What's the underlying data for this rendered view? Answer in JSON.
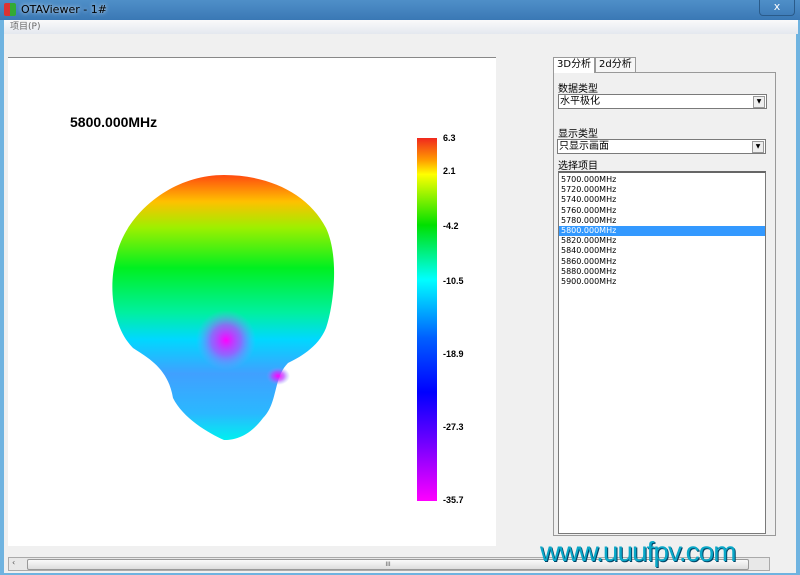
{
  "window": {
    "title": "OTAViewer - 1#",
    "close_label": "x"
  },
  "menu": {
    "project": "项目(P)"
  },
  "plot": {
    "frequency_title": "5800.000MHz",
    "colorbar_ticks": [
      "6.3",
      "2.1",
      "-4.2",
      "-10.5",
      "-18.9",
      "-27.3",
      "-35.7"
    ],
    "colorbar_range": [
      -35.7,
      6.3
    ]
  },
  "tabs": [
    {
      "label": "3D分析",
      "active": true
    },
    {
      "label": "2d分析",
      "active": false
    }
  ],
  "panel": {
    "data_type_label": "数据类型",
    "data_type_value": "水平极化",
    "display_type_label": "显示类型",
    "display_type_value": "只显示画面",
    "select_label": "选择项目",
    "items": [
      "5700.000MHz",
      "5720.000MHz",
      "5740.000MHz",
      "5760.000MHz",
      "5780.000MHz",
      "5800.000MHz",
      "5820.000MHz",
      "5840.000MHz",
      "5860.000MHz",
      "5880.000MHz",
      "5900.000MHz"
    ],
    "selected_index": 5
  },
  "scrollbar": {
    "grip": "III",
    "left_arrow": "‹"
  },
  "watermark": "www.uuufpv.com"
}
